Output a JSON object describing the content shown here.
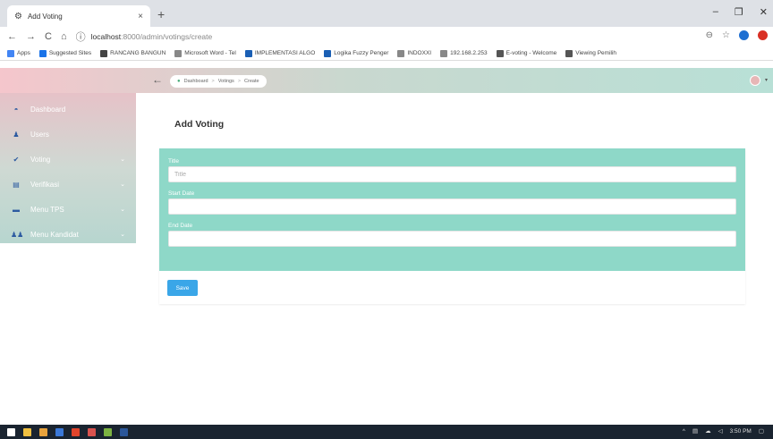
{
  "browser": {
    "tab_title": "Add Voting",
    "tab_icon": "gear-icon",
    "url_host": "localhost",
    "url_path": ":8000/admin/votings/create",
    "bookmarks": [
      {
        "label": "Apps",
        "icon": "apps-icon",
        "color": "#4285f4"
      },
      {
        "label": "Suggested Sites",
        "icon": "bookmark-icon",
        "color": "#1a73e8"
      },
      {
        "label": "RANCANG BANGUN",
        "icon": "bookmark-icon",
        "color": "#444444"
      },
      {
        "label": "Microsoft Word - Tel",
        "icon": "page-icon",
        "color": "#888888"
      },
      {
        "label": "IMPLEMENTASI ALGO",
        "icon": "bookmark-icon",
        "color": "#1a5fb4"
      },
      {
        "label": "Logika Fuzzy Penger",
        "icon": "bookmark-icon",
        "color": "#1a5fb4"
      },
      {
        "label": "INDOXXI",
        "icon": "page-icon",
        "color": "#888888"
      },
      {
        "label": "192.168.2.253",
        "icon": "globe-icon",
        "color": "#888888"
      },
      {
        "label": "E-voting - Welcome",
        "icon": "gear-icon",
        "color": "#555555"
      },
      {
        "label": "Viewing Pemilih",
        "icon": "gear-icon",
        "color": "#555555"
      }
    ]
  },
  "header": {
    "breadcrumb": [
      "Dashboard",
      "Votings",
      "Create"
    ]
  },
  "sidebar": {
    "items": [
      {
        "label": "Dashboard",
        "icon": "dashboard-icon",
        "has_chevron": false
      },
      {
        "label": "Users",
        "icon": "user-icon",
        "has_chevron": false
      },
      {
        "label": "Voting",
        "icon": "check-icon",
        "has_chevron": true
      },
      {
        "label": "Verifikasi",
        "icon": "document-icon",
        "has_chevron": true
      },
      {
        "label": "Menu TPS",
        "icon": "monitor-icon",
        "has_chevron": true
      },
      {
        "label": "Menu Kandidat",
        "icon": "users-icon",
        "has_chevron": true
      }
    ]
  },
  "main": {
    "title": "Add Voting",
    "form": {
      "title_label": "Title",
      "title_placeholder": "Title",
      "start_date_label": "Start Date",
      "end_date_label": "End Date",
      "save_label": "Save"
    }
  },
  "taskbar": {
    "time": "3:50 PM"
  },
  "colors": {
    "form_bg": "#8ed8c8",
    "save_button": "#3aa6e8",
    "sidebar_icon": "#2c5aa0"
  }
}
